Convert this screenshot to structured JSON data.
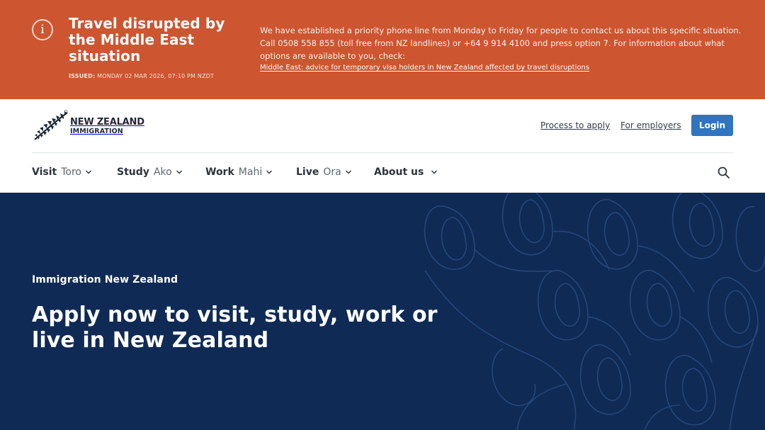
{
  "alert": {
    "title": "Travel disrupted by the Middle East situation",
    "issued_label": "ISSUED:",
    "issued_date": "MONDAY 02 MAR 2026, 07:10 PM NZDT",
    "body": "We have established a priority phone line from Monday to Friday for people to contact us about this specific situation. Call 0508 558 855 (toll free from NZ landlines) or +64 9 914 4100 and press option 7. For information about what options are available to you, check:",
    "link": "Middle East: advice for temporary visa holders in New Zealand affected by travel disruptions",
    "icon": "info-icon",
    "color": "#cd5530"
  },
  "header": {
    "logo_line1": "NEW ZEALAND",
    "logo_line2": "IMMIGRATION",
    "logo_icon": "silver-fern-icon",
    "links": [
      "Process to apply",
      "For employers"
    ],
    "login_label": "Login",
    "accent": "#2f75bf"
  },
  "nav": {
    "items": [
      {
        "label": "Visit",
        "maori": "Toro"
      },
      {
        "label": "Study",
        "maori": "Ako"
      },
      {
        "label": "Work",
        "maori": "Mahi"
      },
      {
        "label": "Live",
        "maori": "Ora"
      },
      {
        "label": "About us",
        "maori": ""
      }
    ],
    "search_icon": "search-icon"
  },
  "hero": {
    "eyebrow": "Immigration New Zealand",
    "title": "Apply now to visit, study, work or live in New Zealand",
    "background": "#0f2a55"
  }
}
